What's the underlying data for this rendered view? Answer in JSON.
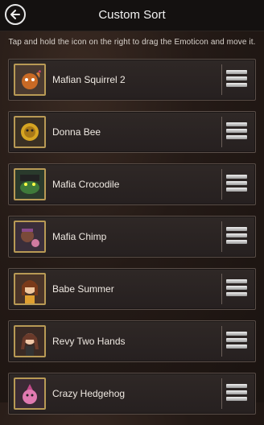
{
  "header": {
    "title": "Custom Sort",
    "back_icon": "arrow-left-icon"
  },
  "hint": "Tap and hold the icon on the right to drag the Emoticon and move it.",
  "items": [
    {
      "label": "Mafian Squirrel 2",
      "icon": "squirrel-avatar-icon",
      "color": "#c96a25"
    },
    {
      "label": "Donna Bee",
      "icon": "bee-avatar-icon",
      "color": "#d6a522"
    },
    {
      "label": "Mafia Crocodile",
      "icon": "crocodile-avatar-icon",
      "color": "#3f7a3a"
    },
    {
      "label": "Mafia Chimp",
      "icon": "chimp-avatar-icon",
      "color": "#8a4a8a"
    },
    {
      "label": "Babe Summer",
      "icon": "summer-avatar-icon",
      "color": "#c8844a"
    },
    {
      "label": "Revy Two Hands",
      "icon": "revy-avatar-icon",
      "color": "#6a3a2a"
    },
    {
      "label": "Crazy Hedgehog",
      "icon": "hedgehog-avatar-icon",
      "color": "#c24a8a"
    }
  ],
  "colors": {
    "background": "#241a16",
    "row": "#2f2826",
    "avatar_border": "#b89a55",
    "text": "#efe9e2"
  }
}
